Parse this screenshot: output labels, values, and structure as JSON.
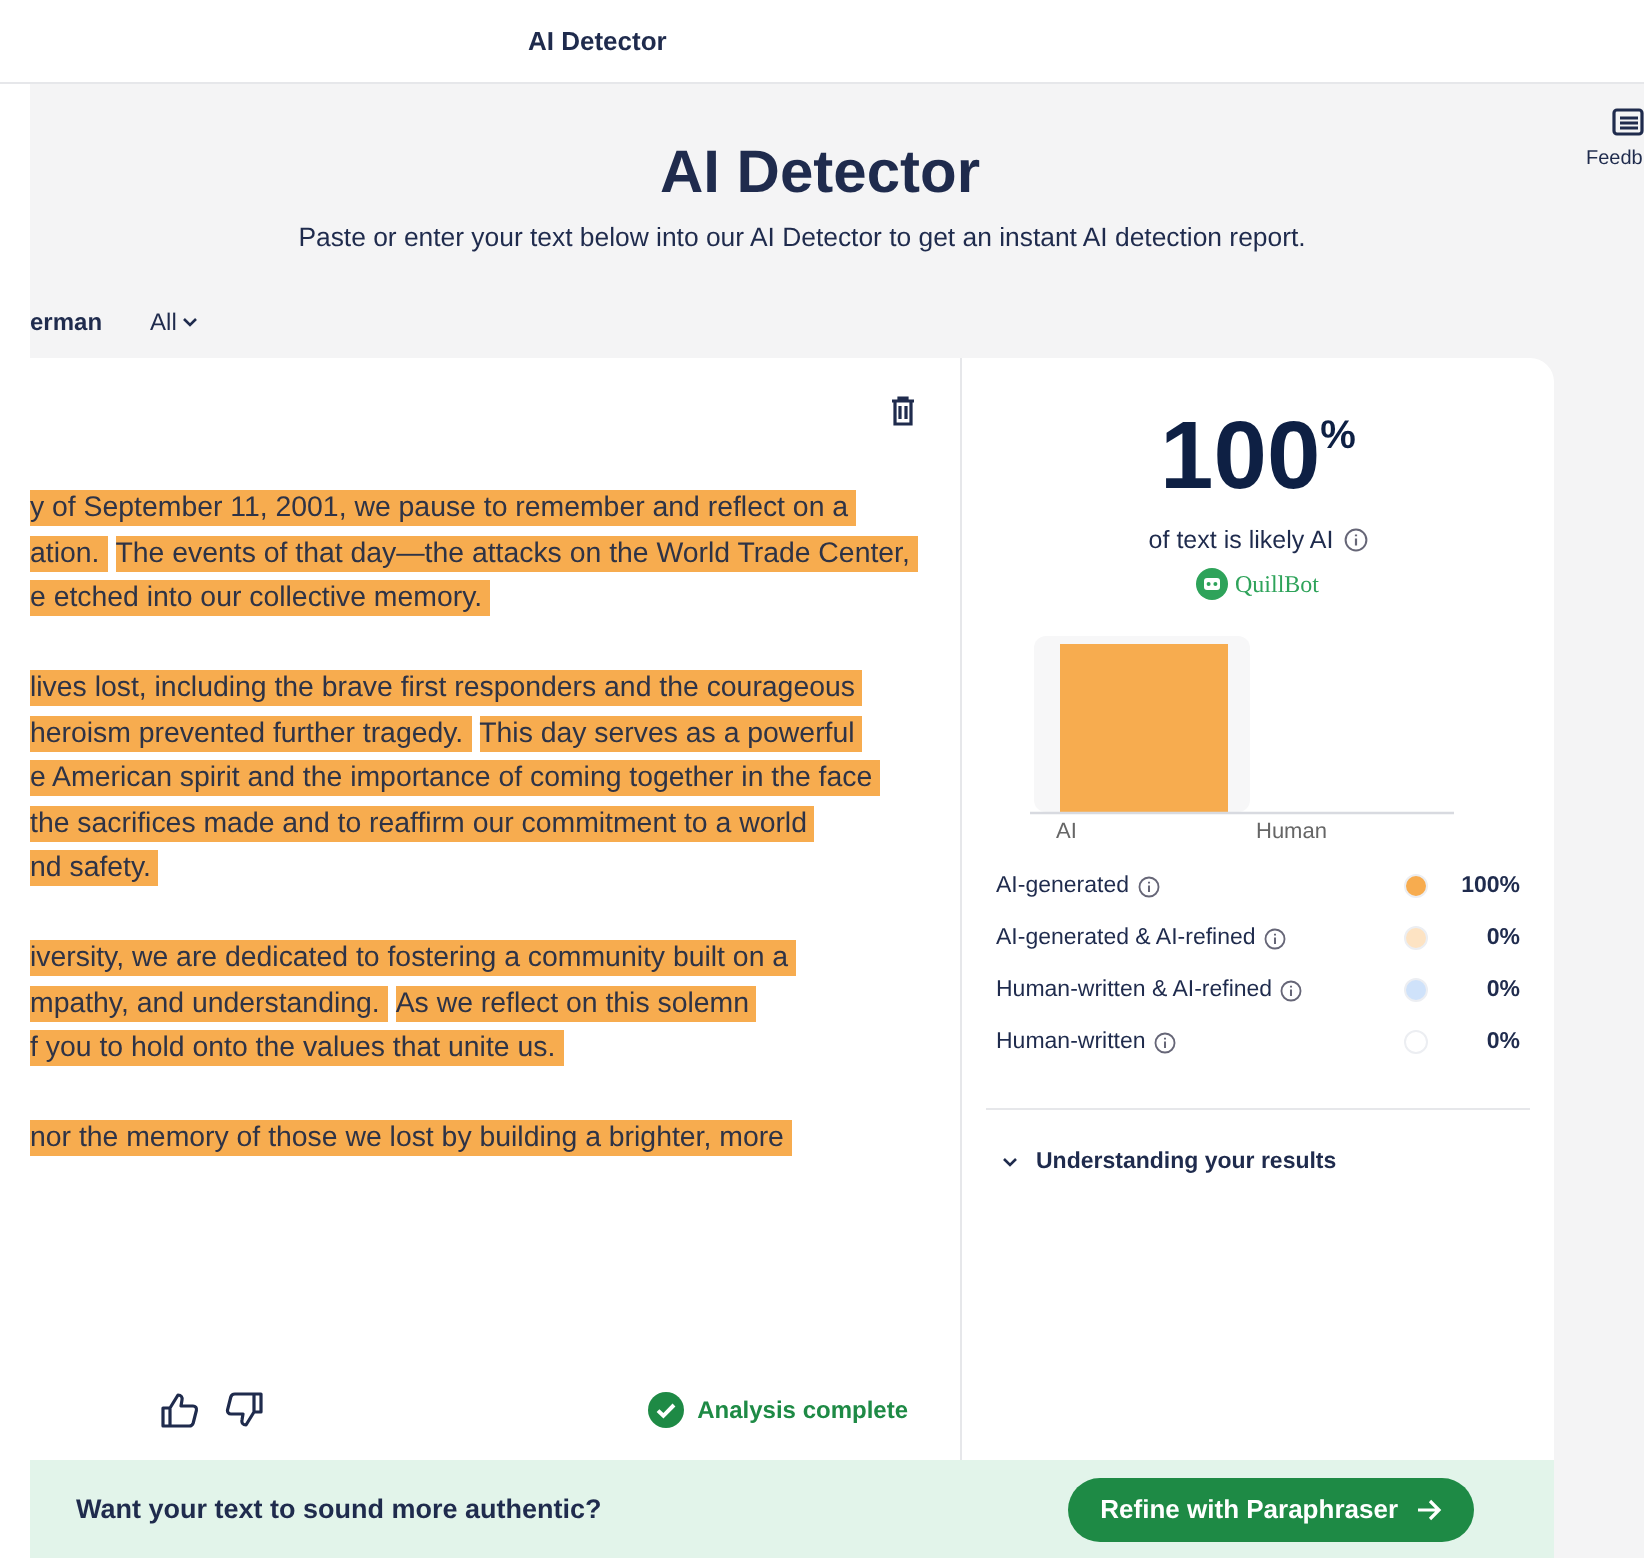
{
  "header": {
    "title": "AI Detector"
  },
  "hero": {
    "title": "AI Detector",
    "subtitle": "Paste or enter your text below into our AI Detector to get an instant AI detection report."
  },
  "language_bar": {
    "items": [
      {
        "label": "erman",
        "kind": "text"
      },
      {
        "label": "All",
        "kind": "dropdown"
      }
    ]
  },
  "editor": {
    "paragraphs": [
      [
        [
          "y of September 11, 2001, we pause to remember and reflect on a"
        ],
        [
          "ation.",
          "The events of that day—the attacks on the World Trade Center,"
        ],
        [
          "e etched into our collective memory."
        ]
      ],
      [
        [
          "lives lost, including the brave first responders and the courageous"
        ],
        [
          "heroism prevented further tragedy.",
          "This day serves as a powerful"
        ],
        [
          "e American spirit and the importance of coming together in the face"
        ],
        [
          "the sacrifices made and to reaffirm our commitment to a world"
        ],
        [
          "nd safety."
        ]
      ],
      [
        [
          "iversity, we are dedicated to fostering a community built on a"
        ],
        [
          "mpathy, and understanding.",
          "As we reflect on this solemn"
        ],
        [
          "f you to hold onto the values that unite us."
        ]
      ],
      [
        [
          "nor the memory of those we lost by building a brighter, more"
        ]
      ]
    ],
    "status": "Analysis complete"
  },
  "results": {
    "score": "100",
    "unit": "%",
    "caption": "of text is likely AI",
    "brand": "QuillBot",
    "chart_axis_labels": [
      "AI",
      "Human"
    ],
    "legend": [
      {
        "label": "AI-generated",
        "color": "#f7ac4f",
        "value": "100%"
      },
      {
        "label": "AI-generated & AI-refined",
        "color": "#fde3c3",
        "value": "0%"
      },
      {
        "label": "Human-written & AI-refined",
        "color": "#cfe2fa",
        "value": "0%"
      },
      {
        "label": "Human-written",
        "color": "#ffffff",
        "value": "0%"
      }
    ],
    "accordion": {
      "label": "Understanding your results",
      "expanded": false
    }
  },
  "banner": {
    "text": "Want your text to sound more authentic?",
    "button": "Refine with Paraphraser"
  },
  "side": {
    "label": "Feedb"
  }
}
